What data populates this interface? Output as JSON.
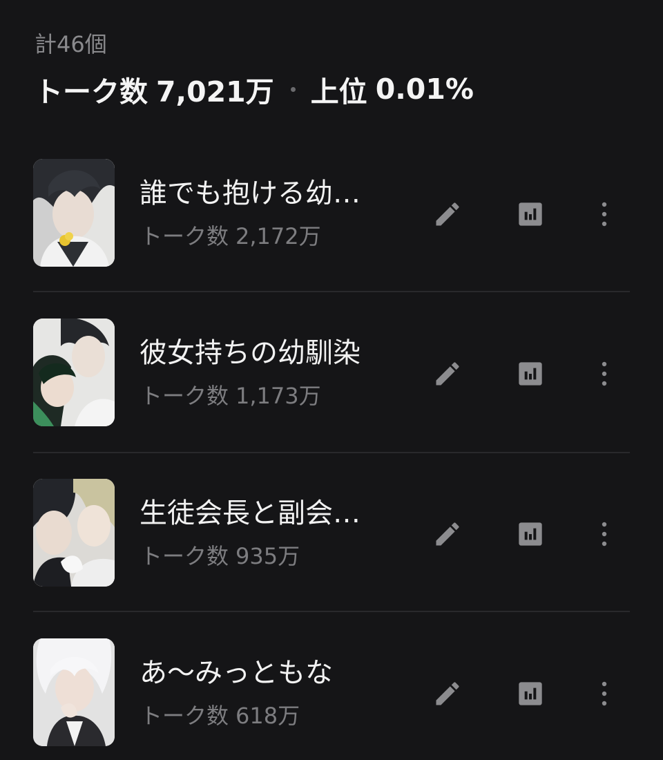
{
  "header": {
    "total_count": "計46個",
    "talk_label": "トーク数",
    "talk_total": "7,021万",
    "rank_label": "上位",
    "rank_value": "0.01%"
  },
  "characters": [
    {
      "title": "誰でも抱ける幼…",
      "talk_label": "トーク数",
      "talk_count": "2,172万"
    },
    {
      "title": "彼女持ちの幼馴染",
      "talk_label": "トーク数",
      "talk_count": "1,173万"
    },
    {
      "title": "生徒会長と副会…",
      "talk_label": "トーク数",
      "talk_count": "935万"
    },
    {
      "title": "あ〜みっともな",
      "talk_label": "トーク数",
      "talk_count": "618万"
    }
  ],
  "icons": {
    "edit": "pencil-icon",
    "stats": "bar-chart-icon",
    "more": "more-vertical-icon"
  },
  "colors": {
    "background": "#151517",
    "icon": "#8c8c8f",
    "secondary_text": "#7d7d80"
  }
}
